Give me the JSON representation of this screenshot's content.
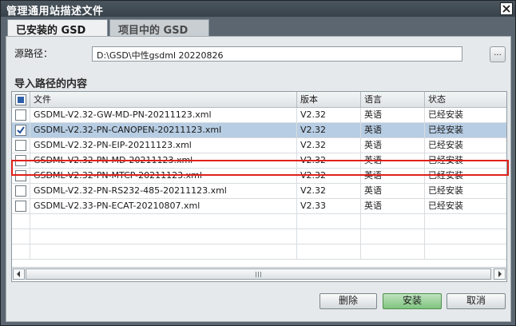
{
  "window": {
    "title": "管理通用站描述文件"
  },
  "tabs": [
    {
      "label": "已安装的 GSD",
      "active": true
    },
    {
      "label": "项目中的 GSD",
      "active": false
    }
  ],
  "source": {
    "label": "源路径：",
    "value": "D:\\GSD\\中性gsdml 20220826",
    "browse_label": "..."
  },
  "section": {
    "title": "导入路径的内容"
  },
  "table": {
    "columns": [
      "文件",
      "版本",
      "语言",
      "状态"
    ],
    "rows": [
      {
        "checked": false,
        "selected": false,
        "file": "GSDML-V2.32-GW-MD-PN-20211123.xml",
        "version": "V2.32",
        "lang": "英语",
        "status": "已经安装"
      },
      {
        "checked": true,
        "selected": true,
        "file": "GSDML-V2.32-PN-CANOPEN-20211123.xml",
        "version": "V2.32",
        "lang": "英语",
        "status": "已经安装"
      },
      {
        "checked": false,
        "selected": false,
        "file": "GSDML-V2.32-PN-EIP-20211123.xml",
        "version": "V2.32",
        "lang": "英语",
        "status": "已经安装"
      },
      {
        "checked": false,
        "selected": false,
        "file": "GSDML-V2.32-PN-MD-20211123.xml",
        "version": "V2.32",
        "lang": "英语",
        "status": "已经安装"
      },
      {
        "checked": false,
        "selected": false,
        "file": "GSDML-V2.32-PN-MTCP-20211123.xml",
        "version": "V2.32",
        "lang": "英语",
        "status": "已经安装"
      },
      {
        "checked": false,
        "selected": false,
        "file": "GSDML-V2.32-PN-RS232-485-20211123.xml",
        "version": "V2.32",
        "lang": "英语",
        "status": "已经安装"
      },
      {
        "checked": false,
        "selected": false,
        "file": "GSDML-V2.33-PN-ECAT-20210807.xml",
        "version": "V2.33",
        "lang": "英语",
        "status": "已经安装"
      }
    ]
  },
  "buttons": {
    "delete": "删除",
    "install": "安装",
    "cancel": "取消"
  },
  "colors": {
    "highlight": "#e0211b",
    "selected_row": "#b7cde3",
    "primary_button": "#7fc47f"
  }
}
